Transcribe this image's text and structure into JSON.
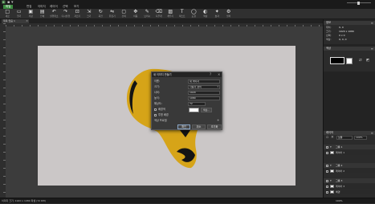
{
  "quick_access": [
    {
      "icon": "app-icon"
    },
    {
      "icon": "quick-save-icon"
    },
    {
      "icon": "dropdown-icon"
    }
  ],
  "menu": {
    "items": [
      {
        "label": "파일",
        "active": true
      },
      {
        "label": "편집"
      },
      {
        "label": "이미지"
      },
      {
        "label": "레이어"
      },
      {
        "label": "선택"
      },
      {
        "label": "보기"
      }
    ]
  },
  "toolbar": {
    "items": [
      {
        "icon": "new-file-icon",
        "label": "새로"
      },
      {
        "icon": "open-folder-icon",
        "label": "열기"
      },
      {
        "icon": "save-file-icon",
        "label": "저장"
      },
      {
        "icon": "print-icon",
        "label": "인쇄"
      },
      {
        "icon": "undo-icon",
        "label": "실행취소"
      },
      {
        "icon": "redo-icon",
        "label": "다시실행"
      },
      {
        "icon": "crop-icon",
        "label": "자르기"
      },
      {
        "icon": "resize-icon",
        "label": "크기"
      },
      {
        "icon": "rotate-icon",
        "label": "회전"
      },
      {
        "icon": "flip-icon",
        "label": "뒤집기"
      },
      {
        "icon": "select-icon",
        "label": "선택"
      },
      {
        "icon": "move-icon",
        "label": "이동"
      },
      {
        "icon": "brush-icon",
        "label": "브러시"
      },
      {
        "icon": "eraser-icon",
        "label": "지우개"
      },
      {
        "icon": "fill-icon",
        "label": "채우기"
      },
      {
        "icon": "text-icon",
        "label": "텍스트"
      },
      {
        "icon": "shape-icon",
        "label": "도형"
      },
      {
        "icon": "color-icon",
        "label": "색상"
      },
      {
        "icon": "effect-icon",
        "label": "효과"
      },
      {
        "icon": "filter-icon",
        "label": "필터"
      }
    ],
    "logo": "FC"
  },
  "tabs": [
    {
      "label": "제목 없음 1"
    }
  ],
  "dialog": {
    "title": "새 이미지 만들기",
    "fields": [
      {
        "label": "이름:",
        "value": "새 이미지"
      },
      {
        "label": "크기:",
        "value": "사용자 정의"
      },
      {
        "label": "너비:",
        "value": "1920"
      },
      {
        "label": "높이:",
        "value": "1080"
      },
      {
        "label": "해상도:",
        "value": "72"
      }
    ],
    "bg_color_label": "배경색",
    "bg_color": "#ffffff",
    "color_button": "색상...",
    "transparent_label": "투명 배경",
    "profile_label": "색상 프로필",
    "buttons": {
      "ok": "확인",
      "cancel": "취소",
      "reset": "초기화"
    }
  },
  "panels": {
    "info": {
      "title": "정보",
      "rows": [
        {
          "label": "위치:",
          "value": "0, 0"
        },
        {
          "label": "크기:",
          "value": "1920 x 1080"
        },
        {
          "label": "선택:",
          "value": "0 x 0"
        },
        {
          "label": "색상:",
          "value": "0, 0, 0"
        }
      ]
    },
    "color": {
      "title": "색상",
      "primary": "#000000",
      "secondary": "#ffffff"
    },
    "layers": {
      "title": "레이어",
      "blend_mode": "보통",
      "opacity": "100%",
      "items": [
        {
          "type": "group",
          "label": "그룹 1"
        },
        {
          "type": "layer",
          "label": "레이어 1"
        },
        {
          "type": "group",
          "label": "그룹 2"
        },
        {
          "type": "layer",
          "label": "레이어 2"
        },
        {
          "type": "group",
          "label": "그룹 3"
        },
        {
          "type": "layer",
          "label": "레이어 3"
        },
        {
          "type": "layer",
          "label": "배경"
        }
      ]
    }
  },
  "status": {
    "text": "이미지 크기: 1920 x 1080 픽셀 (72 DPI)",
    "zoom": "100%"
  },
  "colors": {
    "accent": "#3d8b40",
    "canvas": "#cbc7c7",
    "shape_yellow": "#d6a418",
    "shape_dark": "#141414"
  }
}
